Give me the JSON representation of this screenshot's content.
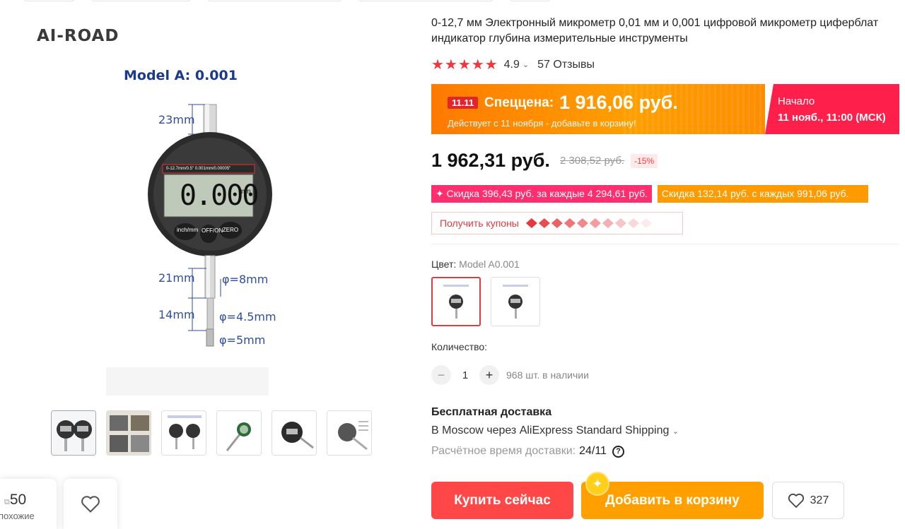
{
  "brand": "AI-ROAD",
  "image": {
    "model_title": "Model A:  0.001",
    "dims": {
      "d1": "23mm",
      "d2": "21mm",
      "d3": "φ=8mm",
      "d4": "14mm",
      "d5": "φ=4.5mm",
      "d6": "φ=5mm"
    },
    "display_reading": "0.000",
    "dial_header": "0-12.7mm/0.5\"  0.001mm/0.00005\"",
    "unit": "mm",
    "buttons": [
      "inch/mm",
      "OFF/ON",
      "ZERO"
    ]
  },
  "thumbnails_count": 6,
  "similar": {
    "count": "50",
    "label": "похожие"
  },
  "product": {
    "title": "0-12,7 мм Электронный микрометр 0,01 мм и 0,001 цифровой микрометр циферблат индикатор глубина измерительные инструменты",
    "rating": {
      "stars": "★★★★★",
      "score": "4.9",
      "reviews": "57 Отзывы"
    }
  },
  "promo": {
    "tag": "11.11",
    "label": "Спеццена:",
    "price": "1 916,06 руб.",
    "subtitle": "Действует с 11 ноября - добавьте в корзину!",
    "start_label": "Начало",
    "start_time": "11 нояб., 11:00 (МСК)"
  },
  "pricing": {
    "price": "1 962,31 руб.",
    "old_price": "2 308,52 руб.",
    "discount": "-15%"
  },
  "deals": {
    "pink": "✦ Скидка 396,43 руб. за каждые 4 294,61 руб.",
    "orange": "Скидка 132,14 руб. с каждых 991,06 руб."
  },
  "coupons": {
    "label": "Получить купоны"
  },
  "color": {
    "label": "Цвет:",
    "value": "Model A0.001"
  },
  "quantity": {
    "label": "Количество:",
    "value": "1",
    "stock": "968 шт. в наличии"
  },
  "shipping": {
    "title": "Бесплатная доставка",
    "via": "В Moscow через AliExpress Standard Shipping",
    "eta_label": "Расчётное время доставки:",
    "eta_date": "24/11"
  },
  "actions": {
    "buy": "Купить сейчас",
    "cart": "Добавить в корзину",
    "wishlist_count": "327"
  },
  "colors": {
    "accent_red": "#ff4747",
    "accent_orange": "#ffa000",
    "star_red": "#f2363c",
    "promo_pink": "#ff1f4b"
  }
}
